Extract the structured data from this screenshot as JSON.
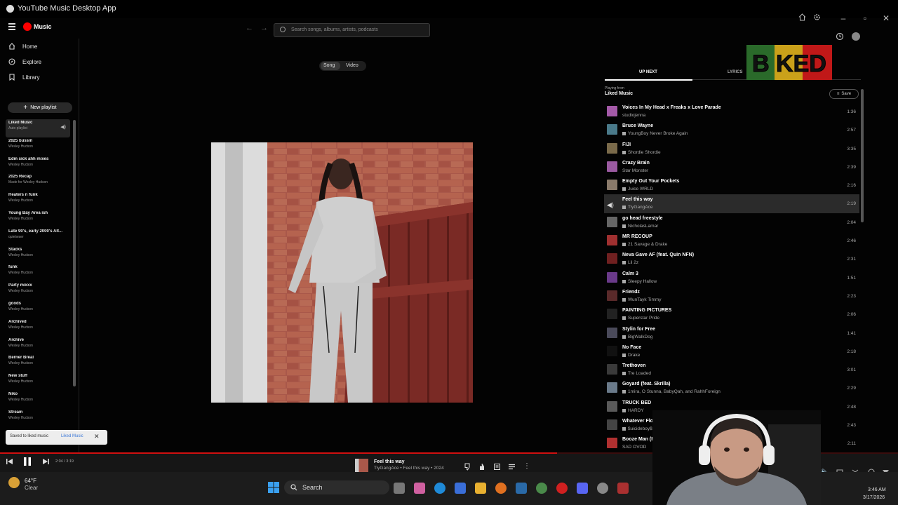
{
  "window": {
    "title": "YouTube Music Desktop App"
  },
  "header": {
    "logo_text": "Music",
    "search_placeholder": "Search songs, albums, artists, podcasts"
  },
  "sidebar": {
    "nav": [
      {
        "label": "Home",
        "icon": "home-icon"
      },
      {
        "label": "Explore",
        "icon": "compass-icon"
      },
      {
        "label": "Library",
        "icon": "library-icon"
      }
    ],
    "new_playlist_label": "New playlist",
    "playlists": [
      {
        "title": "Liked Music",
        "subtitle": "Auto playlist"
      },
      {
        "title": "2025 bussin",
        "subtitle": "Wesley Hudson"
      },
      {
        "title": "Edm sick ahh mixes",
        "subtitle": "Wesley Hudson"
      },
      {
        "title": "2025 Recap",
        "subtitle": "Made for Wesley Hudson"
      },
      {
        "title": "Heaters n funk",
        "subtitle": "Wesley Hudson"
      },
      {
        "title": "Young Bay Area ish",
        "subtitle": "Wesley Hudson"
      },
      {
        "title": "Late 90's, early 2000's Alt...",
        "subtitle": "quietwaer"
      },
      {
        "title": "Stacks",
        "subtitle": "Wesley Hudson"
      },
      {
        "title": "funk",
        "subtitle": "Wesley Hudson"
      },
      {
        "title": "Party mixxx",
        "subtitle": "Wesley Hudson"
      },
      {
        "title": "goods",
        "subtitle": "Wesley Hudson"
      },
      {
        "title": "Archived",
        "subtitle": "Wesley Hudson"
      },
      {
        "title": "Archive",
        "subtitle": "Wesley Hudson"
      },
      {
        "title": "Berner Breal",
        "subtitle": "Wesley Hudson"
      },
      {
        "title": "New stuff",
        "subtitle": "Wesley Hudson"
      },
      {
        "title": "Niko",
        "subtitle": "Wesley Hudson"
      },
      {
        "title": "Stream",
        "subtitle": "Wesley Hudson"
      }
    ]
  },
  "toast": {
    "message": "Saved to liked music",
    "link": "Liked Music"
  },
  "toggle": {
    "song": "Song",
    "video": "Video"
  },
  "panel": {
    "tab_upnext": "UP NEXT",
    "tab_lyrics": "LYRICS",
    "playing_from_label": "Playing from",
    "playing_from": "Liked Music",
    "save_label": "Save"
  },
  "queue": [
    {
      "title": "Voices In My Head x Freaks x Love Parade",
      "artist": "studiojenna",
      "duration": "1:36",
      "explicit": false,
      "color": "#a45aa8"
    },
    {
      "title": "Bruce Wayne",
      "artist": "YoungBoy Never Broke Again",
      "duration": "2:57",
      "explicit": true,
      "color": "#4a7a8a"
    },
    {
      "title": "FIJI",
      "artist": "Shordie Shordie",
      "duration": "3:35",
      "explicit": true,
      "color": "#7a6a4a"
    },
    {
      "title": "Crazy Brain",
      "artist": "Star Monster",
      "duration": "2:39",
      "explicit": false,
      "color": "#9a5aa0"
    },
    {
      "title": "Empty Out Your Pockets",
      "artist": "Juice WRLD",
      "duration": "2:16",
      "explicit": true,
      "color": "#8a7a6a"
    },
    {
      "title": "Feel this way",
      "artist": "TiyGangAce",
      "duration": "2:19",
      "explicit": true,
      "color": "#555555",
      "current": true
    },
    {
      "title": "go head freestyle",
      "artist": "NicholasLamar",
      "duration": "2:04",
      "explicit": true,
      "color": "#666666"
    },
    {
      "title": "MR RECOUP",
      "artist": "21 Savage & Drake",
      "duration": "2:46",
      "explicit": true,
      "color": "#a03030"
    },
    {
      "title": "Neva Gave AF (feat. Quin NFN)",
      "artist": "Lil 2z",
      "duration": "2:31",
      "explicit": true,
      "color": "#702020"
    },
    {
      "title": "Calm 3",
      "artist": "Sleepy Hallow",
      "duration": "1:51",
      "explicit": true,
      "color": "#6a3a8a"
    },
    {
      "title": "Friendz",
      "artist": "WunTayk Timmy",
      "duration": "2:23",
      "explicit": true,
      "color": "#5a2a2a"
    },
    {
      "title": "PAINTING PICTURES",
      "artist": "Superstar Pride",
      "duration": "2:06",
      "explicit": true,
      "color": "#222222"
    },
    {
      "title": "Stylin for Free",
      "artist": "BigWalkDog",
      "duration": "1:41",
      "explicit": true,
      "color": "#4a4a5a"
    },
    {
      "title": "No Face",
      "artist": "Drake",
      "duration": "2:18",
      "explicit": true,
      "color": "#111111"
    },
    {
      "title": "Trethoven",
      "artist": "Tre Loaded",
      "duration": "3:01",
      "explicit": true,
      "color": "#3a3a3a"
    },
    {
      "title": "Goyard (feat. Skrilla)",
      "artist": "1mira, O Stunna, BabyQah, and RahhForeign",
      "duration": "2:29",
      "explicit": true,
      "color": "#6a7a8a"
    },
    {
      "title": "TRUCK BED",
      "artist": "HARDY",
      "duration": "2:48",
      "explicit": true,
      "color": "#5a5a5a"
    },
    {
      "title": "Whatever Floats Your Boat Will De...",
      "artist": "$uicideboy$",
      "duration": "2:43",
      "explicit": true,
      "color": "#444444"
    },
    {
      "title": "Booze Man (Remix)",
      "artist": "SAD OVOD",
      "duration": "2:11",
      "explicit": false,
      "color": "#b03030"
    }
  ],
  "player": {
    "time": "2:04 / 3:19",
    "progress": 0.62,
    "title": "Feel this way",
    "subtitle": "TiyGangAce • Feel this way • 2024"
  },
  "taskbar": {
    "weather_temp": "64°F",
    "weather_cond": "Clear",
    "search_label": "Search",
    "time": "3:46 AM",
    "date": "3/17/2026"
  },
  "overlay_logo": "B KED",
  "colors": {
    "accent": "#ff0000",
    "progress": "#d01010"
  }
}
